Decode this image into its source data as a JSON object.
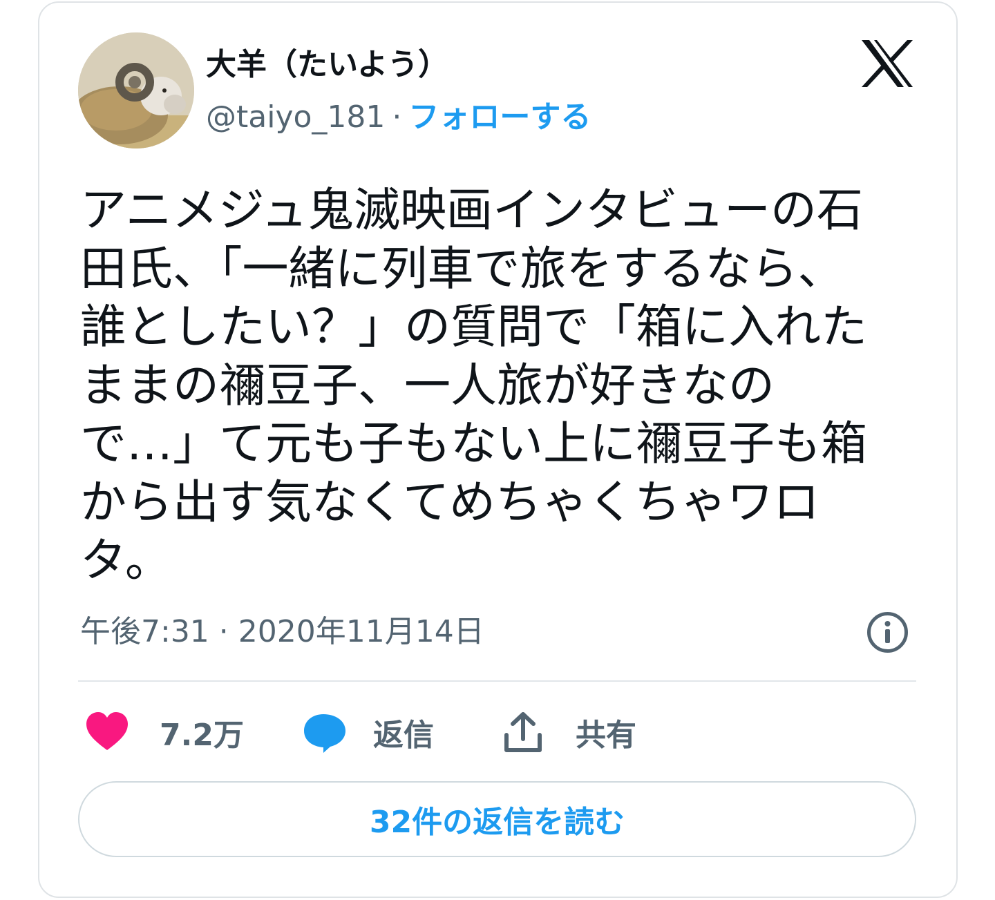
{
  "author": {
    "display_name": "大羊（たいよう）",
    "handle": "@taiyo_181",
    "separator": "·",
    "follow_label": "フォローする",
    "avatar_icon": "sheep-avatar-photo"
  },
  "brand": {
    "logo_icon": "x-logo-icon"
  },
  "tweet": {
    "text": "アニメジュ鬼滅映画インタビューの石\n田氏、「一緒に列車で旅をするなら、\n誰としたい？」の質問で「箱に入れた\nままの禰豆子、一人旅が好きなの\nで…」て元も子もない上に禰豆子も箱\nから出す気なくてめちゃくちゃワロ\nタ。",
    "timestamp": "午後7:31 · 2020年11月14日"
  },
  "actions": {
    "like_count": "7.2万",
    "reply_label": "返信",
    "share_label": "共有"
  },
  "read_replies_label": "32件の返信を読む",
  "colors": {
    "accent": "#1d9bf0",
    "like": "#f91880",
    "secondary_text": "#536471",
    "border": "#cfd9de"
  }
}
